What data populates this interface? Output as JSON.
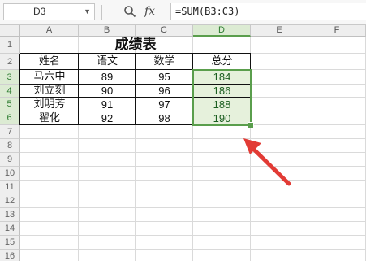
{
  "formula_bar": {
    "name_box": "D3",
    "fx_label": "fx",
    "formula": "=SUM(B3:C3)"
  },
  "columns": [
    "A",
    "B",
    "C",
    "D",
    "E",
    "F"
  ],
  "rows": [
    "1",
    "2",
    "3",
    "4",
    "5",
    "6",
    "7",
    "8",
    "9",
    "10",
    "11",
    "12",
    "13",
    "14",
    "15",
    "16"
  ],
  "sheet": {
    "title": "成绩表",
    "headers": [
      "姓名",
      "语文",
      "数学",
      "总分"
    ],
    "records": [
      [
        "马六中",
        "89",
        "95",
        "184"
      ],
      [
        "刘立刻",
        "90",
        "96",
        "186"
      ],
      [
        "刘明芳",
        "91",
        "97",
        "188"
      ],
      [
        "翟化",
        "92",
        "98",
        "190"
      ]
    ]
  },
  "selection": {
    "range": "D3:D6",
    "active_cell": "D3"
  },
  "colors": {
    "selection_border": "#5a9e4c",
    "selection_fill": "#e6f1dc",
    "arrow": "#e23b35"
  },
  "icons": [
    "zoom-icon",
    "fx-icon",
    "dropdown-arrow-icon",
    "red-arrow-annotation"
  ]
}
